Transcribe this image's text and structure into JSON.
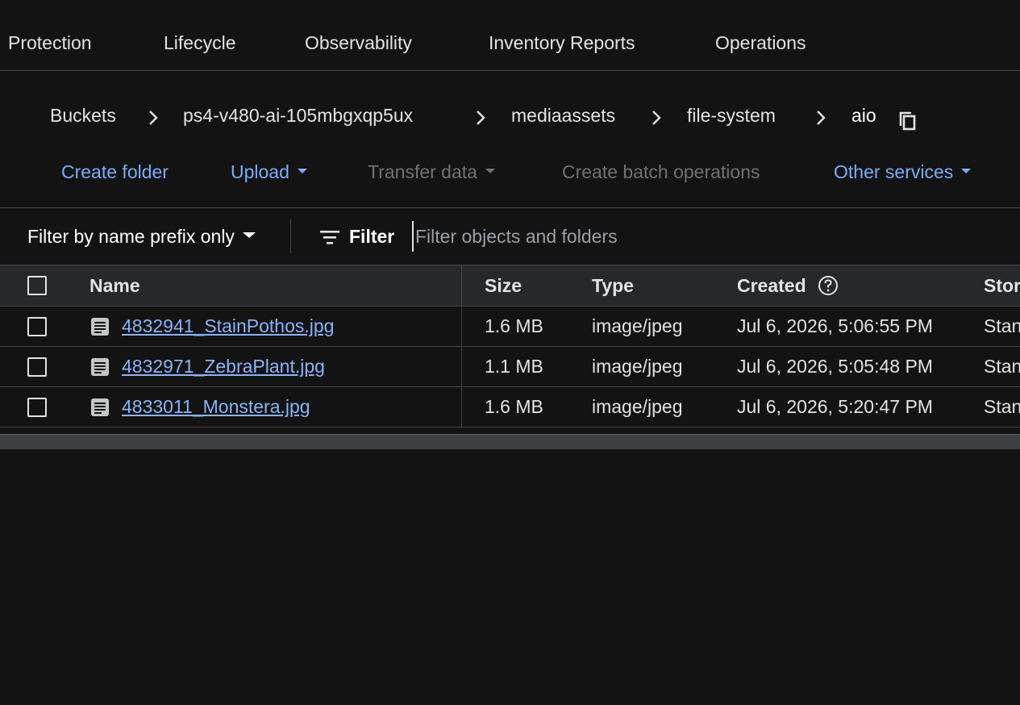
{
  "tabs": [
    "Protection",
    "Lifecycle",
    "Observability",
    "Inventory Reports",
    "Operations"
  ],
  "breadcrumb": {
    "items": [
      "Buckets",
      "ps4-v480-ai-105mbgxqp5ux",
      "mediaassets",
      "file-system"
    ],
    "current": "aio"
  },
  "toolbar": {
    "create_folder": "Create folder",
    "upload": "Upload",
    "transfer_data": "Transfer data",
    "create_batch": "Create batch operations",
    "other_services": "Other services"
  },
  "filter": {
    "mode": "Filter by name prefix only",
    "label": "Filter",
    "placeholder": "Filter objects and folders"
  },
  "table": {
    "columns": {
      "name": "Name",
      "size": "Size",
      "type": "Type",
      "created": "Created",
      "storage": "Stor"
    },
    "rows": [
      {
        "name": "4832941_StainPothos.jpg",
        "size": "1.6 MB",
        "type": "image/jpeg",
        "created": "Jul 6, 2026, 5:06:55 PM",
        "storage": "Stan"
      },
      {
        "name": "4832971_ZebraPlant.jpg",
        "size": "1.1 MB",
        "type": "image/jpeg",
        "created": "Jul 6, 2026, 5:05:48 PM",
        "storage": "Stan"
      },
      {
        "name": "4833011_Monstera.jpg",
        "size": "1.6 MB",
        "type": "image/jpeg",
        "created": "Jul 6, 2026, 5:20:47 PM",
        "storage": "Stan"
      }
    ]
  },
  "colors": {
    "background": "#131314",
    "link": "#8ab4f8",
    "action": "#7cacf8",
    "disabled": "#6f7175",
    "header_bg": "#27282b"
  }
}
